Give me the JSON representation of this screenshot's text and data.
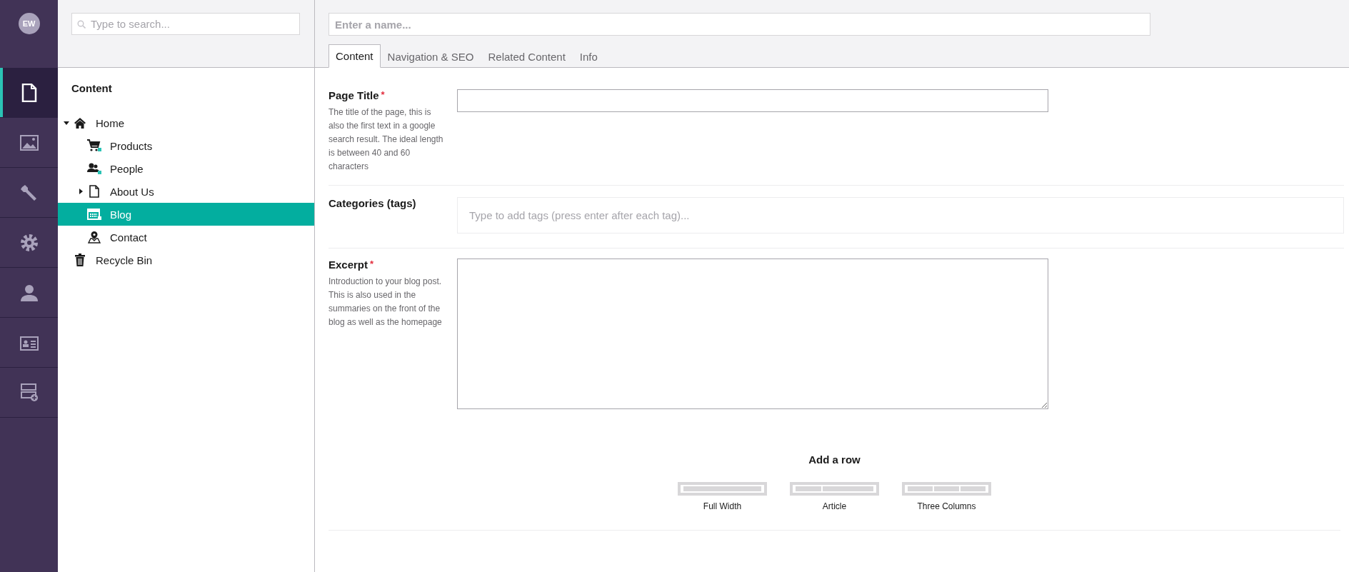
{
  "user": {
    "initials": "EW"
  },
  "sections": [
    {
      "kind": "document",
      "selected": true
    },
    {
      "kind": "image",
      "selected": false
    },
    {
      "kind": "wrench",
      "selected": false
    },
    {
      "kind": "gear",
      "selected": false
    },
    {
      "kind": "person",
      "selected": false
    },
    {
      "kind": "id-card",
      "selected": false
    },
    {
      "kind": "layout-add",
      "selected": false
    }
  ],
  "tree": {
    "search": {
      "placeholder": "Type to search..."
    },
    "title": "Content",
    "items": [
      {
        "label": "Home",
        "kind": "home",
        "expanded": true,
        "selected": false,
        "children": [
          {
            "label": "Products",
            "kind": "cart",
            "selected": false
          },
          {
            "label": "People",
            "kind": "people",
            "selected": false
          },
          {
            "label": "About Us",
            "kind": "document",
            "expanded": false,
            "selected": false
          },
          {
            "label": "Blog",
            "kind": "calendar",
            "selected": true
          },
          {
            "label": "Contact",
            "kind": "pin",
            "selected": false
          }
        ]
      },
      {
        "label": "Recycle Bin",
        "kind": "trash",
        "selected": false
      }
    ]
  },
  "editor": {
    "name": {
      "placeholder": "Enter a name..."
    },
    "tabs": [
      {
        "label": "Content",
        "selected": true
      },
      {
        "label": "Navigation & SEO",
        "selected": false
      },
      {
        "label": "Related Content",
        "selected": false
      },
      {
        "label": "Info",
        "selected": false
      }
    ],
    "required_mark": "*",
    "fields": [
      {
        "kind": "text",
        "label": "Page Title",
        "required": true,
        "description": "The title of the page, this is also the first text in a google search result. The ideal length is between 40 and 60 characters"
      },
      {
        "kind": "tags",
        "label": "Categories (tags)",
        "required": false,
        "placeholder": "Type to add tags (press enter after each tag)..."
      },
      {
        "kind": "textarea",
        "label": "Excerpt",
        "required": true,
        "description": "Introduction to your blog post. This is also used in the summaries on the front of the blog as well as the homepage"
      }
    ],
    "grid": {
      "title": "Add a row",
      "layouts": [
        {
          "kind": "full",
          "label": "Full Width"
        },
        {
          "kind": "article",
          "label": "Article"
        },
        {
          "kind": "three",
          "label": "Three Columns"
        }
      ]
    }
  }
}
